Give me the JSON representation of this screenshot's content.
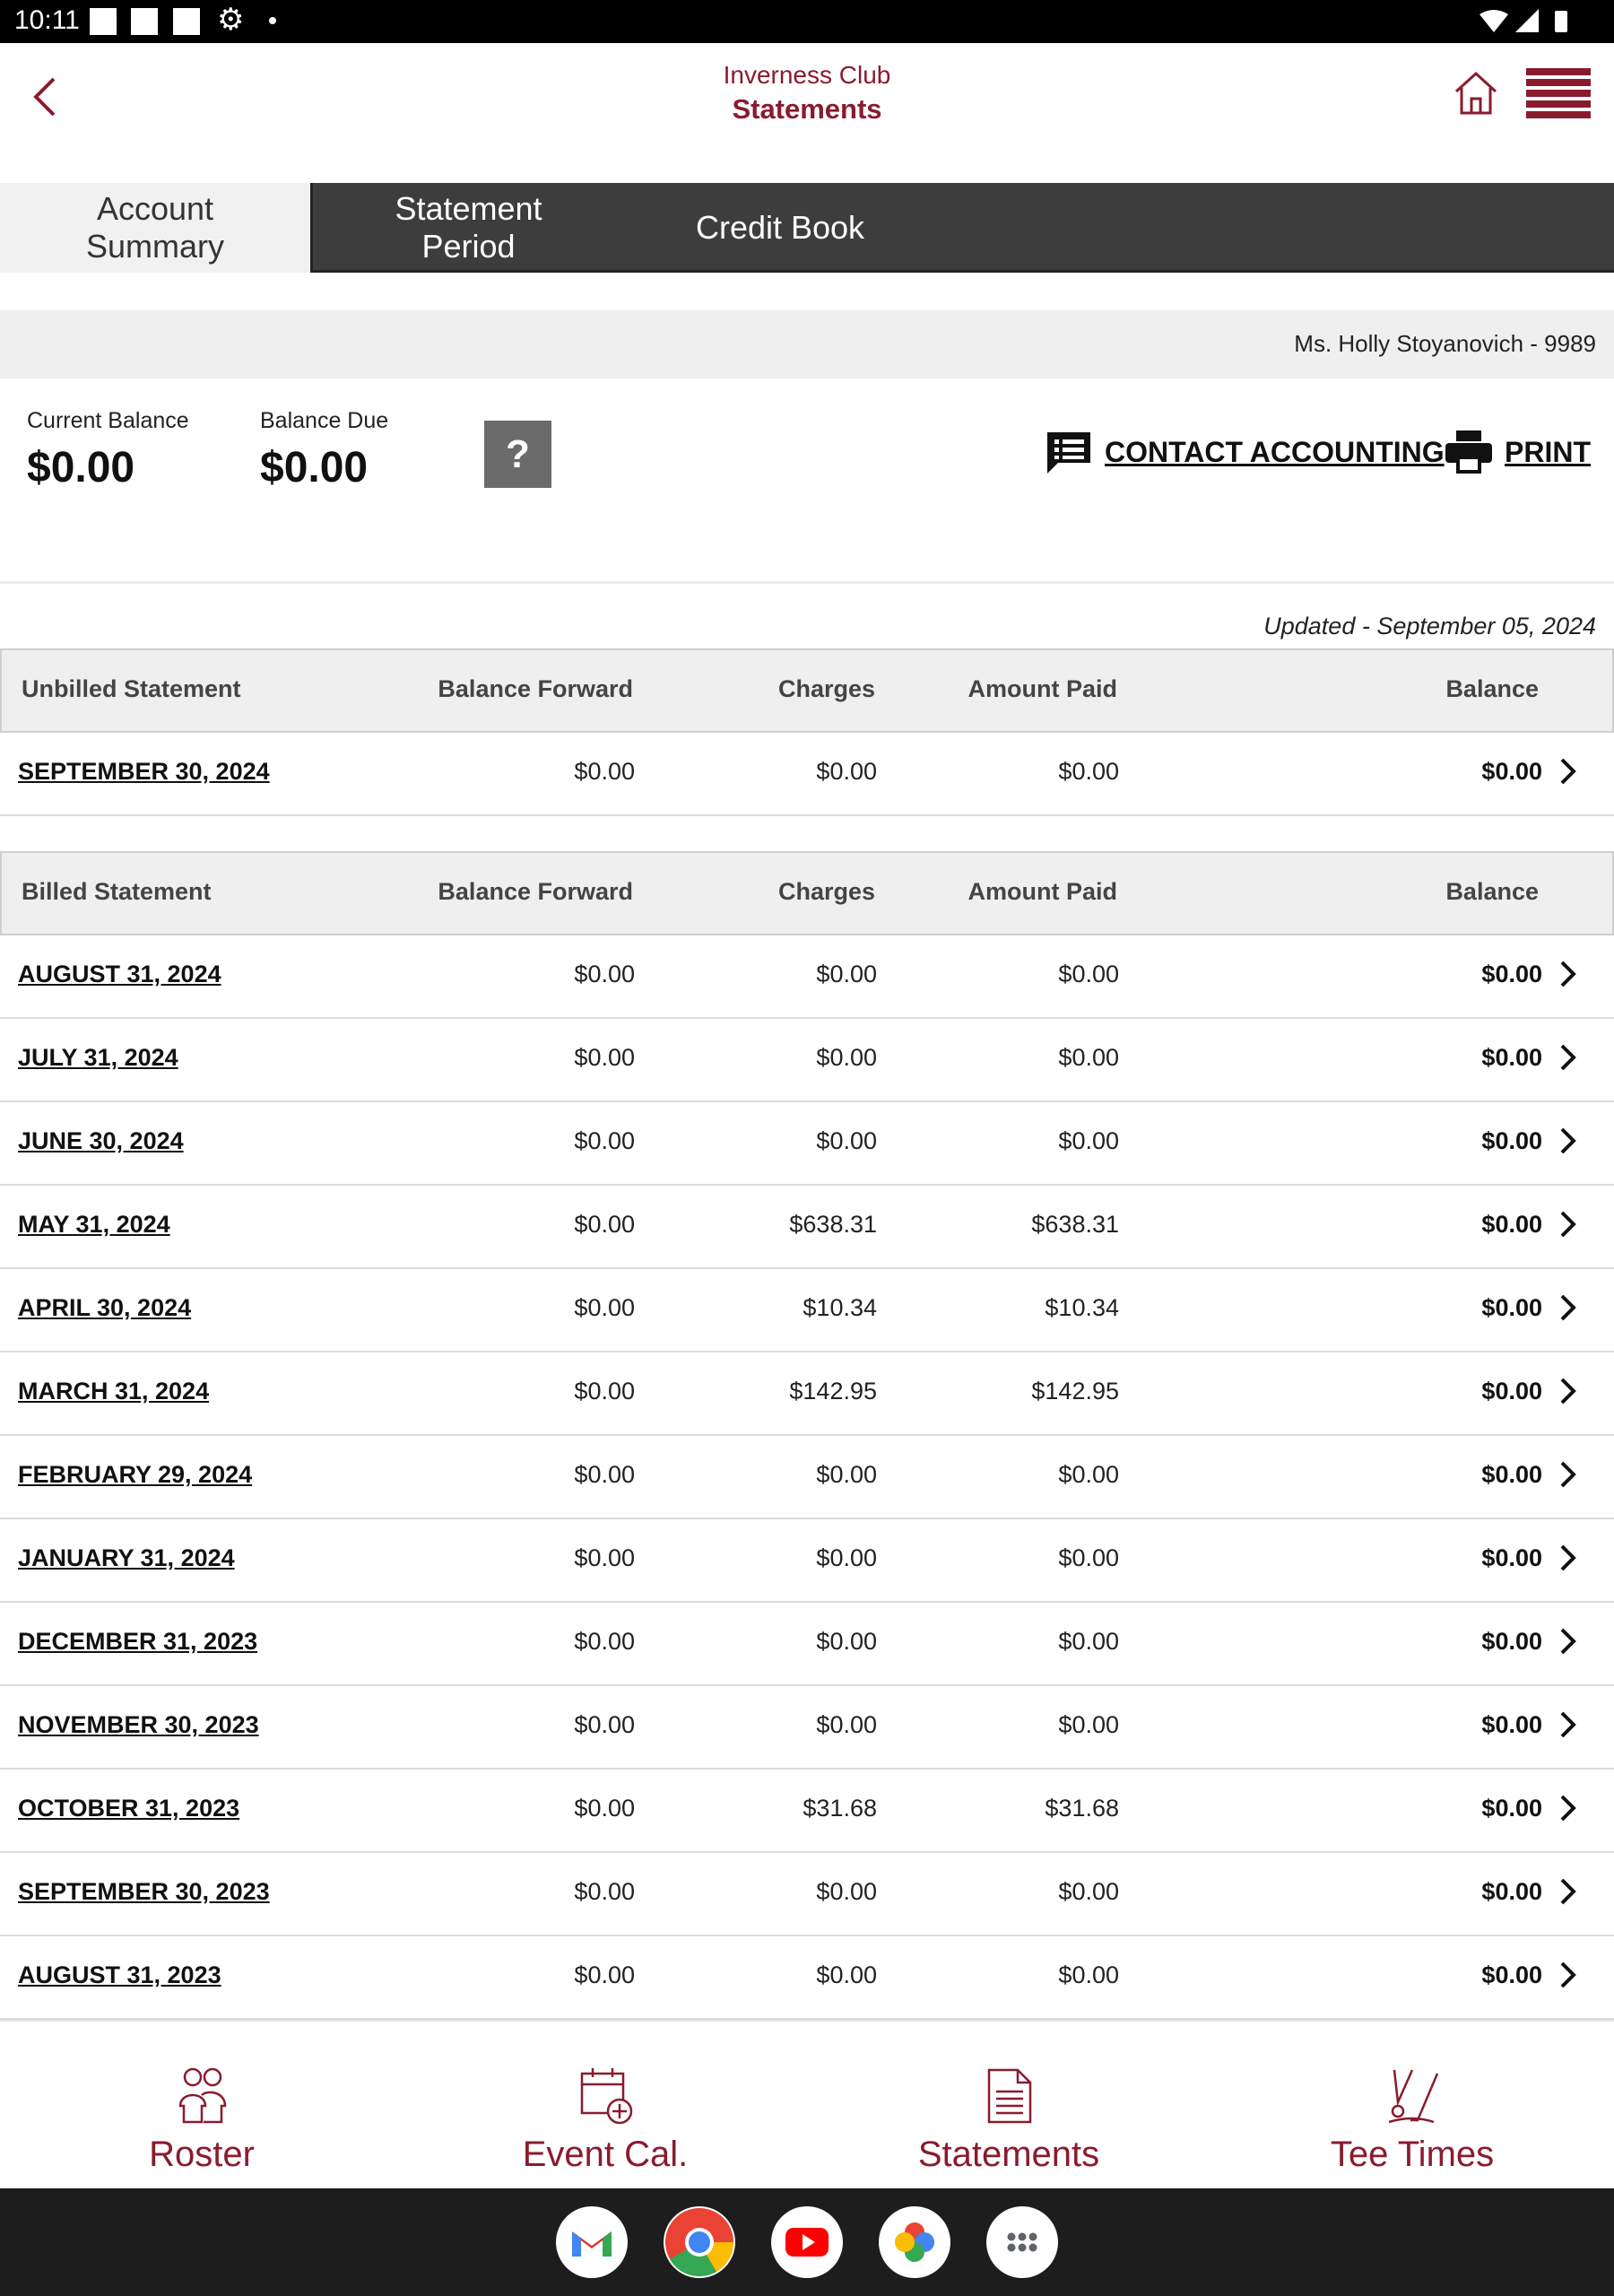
{
  "status_bar": {
    "time": "10:11"
  },
  "header": {
    "club_name": "Inverness Club",
    "title": "Statements"
  },
  "tabs": [
    {
      "label": "Account Summary",
      "active": true
    },
    {
      "label": "Statement Period",
      "active": false
    },
    {
      "label": "Credit Book",
      "active": false
    }
  ],
  "member": {
    "name": "Ms. Holly Stoyanovich - 9989"
  },
  "balances": {
    "current_label": "Current Balance",
    "current_value": "$0.00",
    "due_label": "Balance Due",
    "due_value": "$0.00",
    "help": "?"
  },
  "actions": {
    "contact": "CONTACT ACCOUNTING",
    "print": "PRINT"
  },
  "updated": "Updated - September 05, 2024",
  "unbilled": {
    "headers": {
      "statement": "Unbilled Statement",
      "balance_forward": "Balance Forward",
      "charges": "Charges",
      "amount_paid": "Amount Paid",
      "balance": "Balance"
    },
    "rows": [
      {
        "date": "SEPTEMBER 30, 2024",
        "balance_forward": "$0.00",
        "charges": "$0.00",
        "amount_paid": "$0.00",
        "balance": "$0.00"
      }
    ]
  },
  "billed": {
    "headers": {
      "statement": "Billed Statement",
      "balance_forward": "Balance Forward",
      "charges": "Charges",
      "amount_paid": "Amount Paid",
      "balance": "Balance"
    },
    "rows": [
      {
        "date": "AUGUST 31, 2024",
        "balance_forward": "$0.00",
        "charges": "$0.00",
        "amount_paid": "$0.00",
        "balance": "$0.00"
      },
      {
        "date": "JULY 31, 2024",
        "balance_forward": "$0.00",
        "charges": "$0.00",
        "amount_paid": "$0.00",
        "balance": "$0.00"
      },
      {
        "date": "JUNE 30, 2024",
        "balance_forward": "$0.00",
        "charges": "$0.00",
        "amount_paid": "$0.00",
        "balance": "$0.00"
      },
      {
        "date": "MAY 31, 2024",
        "balance_forward": "$0.00",
        "charges": "$638.31",
        "amount_paid": "$638.31",
        "balance": "$0.00"
      },
      {
        "date": "APRIL 30, 2024",
        "balance_forward": "$0.00",
        "charges": "$10.34",
        "amount_paid": "$10.34",
        "balance": "$0.00"
      },
      {
        "date": "MARCH 31, 2024",
        "balance_forward": "$0.00",
        "charges": "$142.95",
        "amount_paid": "$142.95",
        "balance": "$0.00"
      },
      {
        "date": "FEBRUARY 29, 2024",
        "balance_forward": "$0.00",
        "charges": "$0.00",
        "amount_paid": "$0.00",
        "balance": "$0.00"
      },
      {
        "date": "JANUARY 31, 2024",
        "balance_forward": "$0.00",
        "charges": "$0.00",
        "amount_paid": "$0.00",
        "balance": "$0.00"
      },
      {
        "date": "DECEMBER 31, 2023",
        "balance_forward": "$0.00",
        "charges": "$0.00",
        "amount_paid": "$0.00",
        "balance": "$0.00"
      },
      {
        "date": "NOVEMBER 30, 2023",
        "balance_forward": "$0.00",
        "charges": "$0.00",
        "amount_paid": "$0.00",
        "balance": "$0.00"
      },
      {
        "date": "OCTOBER 31, 2023",
        "balance_forward": "$0.00",
        "charges": "$31.68",
        "amount_paid": "$31.68",
        "balance": "$0.00"
      },
      {
        "date": "SEPTEMBER 30, 2023",
        "balance_forward": "$0.00",
        "charges": "$0.00",
        "amount_paid": "$0.00",
        "balance": "$0.00"
      },
      {
        "date": "AUGUST 31, 2023",
        "balance_forward": "$0.00",
        "charges": "$0.00",
        "amount_paid": "$0.00",
        "balance": "$0.00"
      }
    ]
  },
  "bottom_nav": [
    {
      "label": "Roster",
      "icon": "roster-icon"
    },
    {
      "label": "Event Cal.",
      "icon": "event-calendar-icon"
    },
    {
      "label": "Statements",
      "icon": "statements-icon"
    },
    {
      "label": "Tee Times",
      "icon": "tee-times-icon"
    }
  ],
  "dock_apps": [
    "gmail-icon",
    "chrome-icon",
    "youtube-icon",
    "photos-icon",
    "app-drawer-icon"
  ],
  "colors": {
    "brand": "#8a1b2e",
    "tab_bar": "#3d3d3d",
    "header_bg": "#efefef"
  }
}
